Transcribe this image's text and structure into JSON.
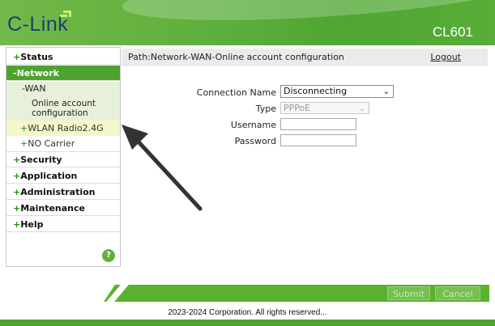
{
  "header": {
    "logo_text": "C-Link",
    "model": "CL601"
  },
  "sidebar": {
    "status": "Status",
    "network": "Network",
    "wan": "WAN",
    "online_account_line1": "Online account",
    "online_account_line2": "configuration",
    "wlan_radio": "WLAN Radio2.4G",
    "no_carrier": "NO Carrier",
    "security": "Security",
    "application": "Application",
    "administration": "Administration",
    "maintenance": "Maintenance",
    "help": "Help",
    "help_icon": "?"
  },
  "pathbar": {
    "path": "Path:Network-WAN-Online account configuration",
    "logout": "Logout"
  },
  "form": {
    "connection_name_label": "Connection Name",
    "connection_name_value": "Disconnecting",
    "type_label": "Type",
    "type_value": "PPPoE",
    "username_label": "Username",
    "username_value": "",
    "password_label": "Password",
    "password_value": ""
  },
  "footer": {
    "submit": "Submit",
    "cancel": "Cancel",
    "copyright": "2023-2024 Corporation. All rights reserved..."
  },
  "colors": {
    "brand_green": "#4da32e",
    "logo_blue": "#1d3f73",
    "arrow": "#333333"
  }
}
